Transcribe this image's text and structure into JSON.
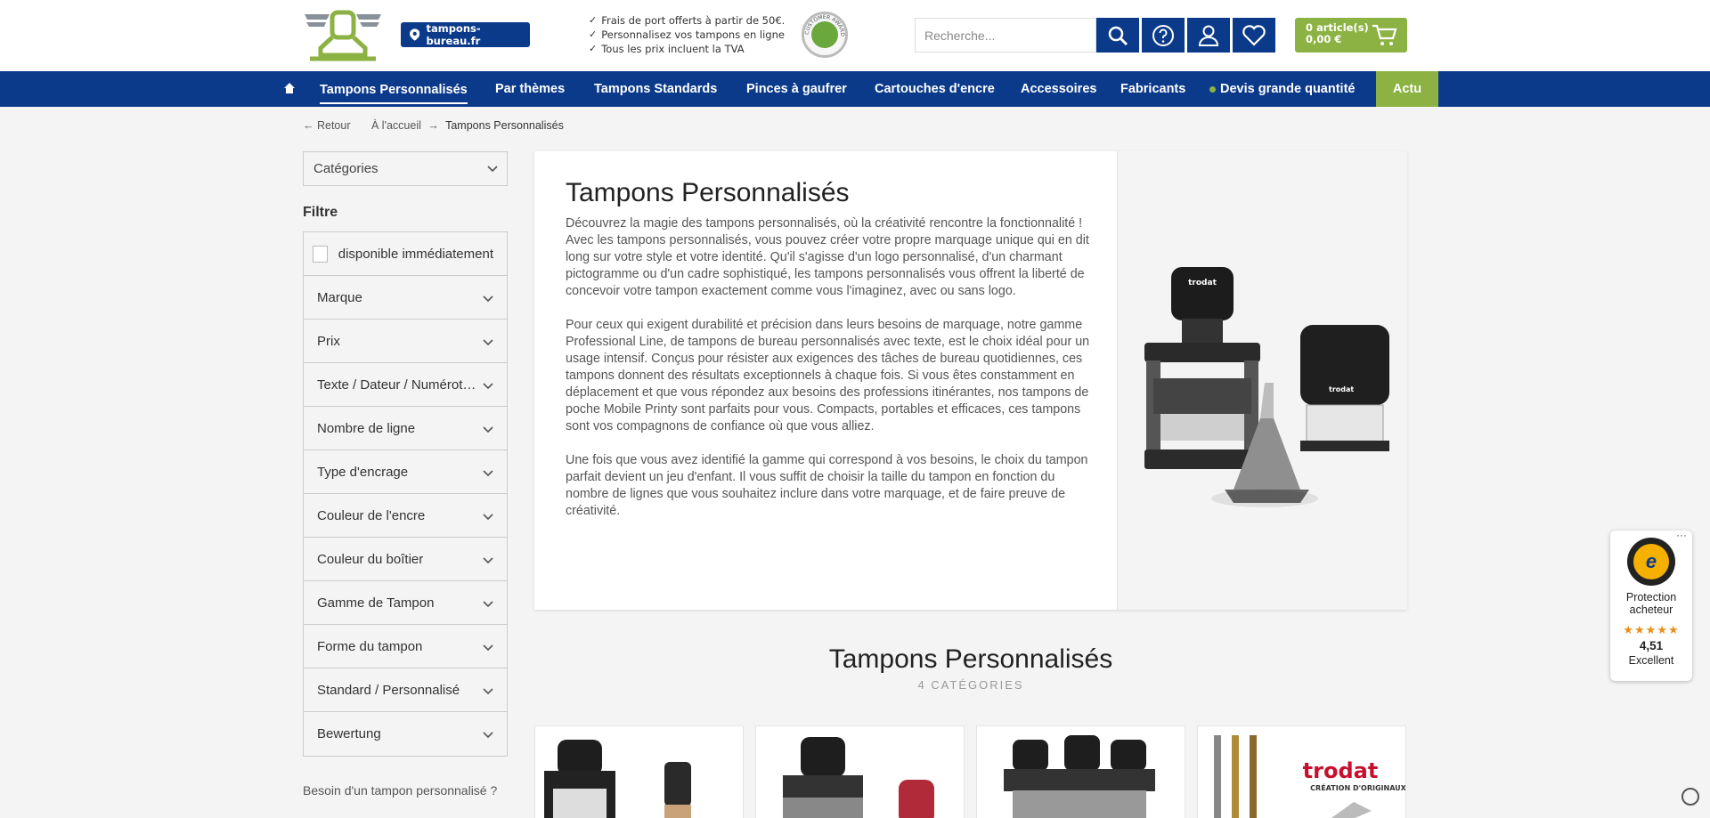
{
  "header": {
    "shop_button": "tampons-bureau.fr",
    "usps": [
      "Frais de port offerts à partir de 50€.",
      "Personnalisez vos tampons en ligne",
      "Tous les prix incluent la TVA"
    ],
    "award_text": "CUSTOMER AWARD",
    "search_placeholder": "Recherche...",
    "cart_items": "0 article(s)",
    "cart_total": "0,00 €",
    "icons": [
      "search-icon",
      "help-icon",
      "account-icon",
      "wishlist-icon",
      "cart-icon"
    ],
    "accent_color": "#0b3a8a",
    "brand_green": "#8cb243"
  },
  "nav": {
    "items": [
      "Tampons Personnalisés",
      "Par thèmes",
      "Tampons Standards",
      "Pinces à gaufrer",
      "Cartouches d'encre",
      "Accessoires",
      "Fabricants",
      "Devis grande quantité"
    ],
    "actu": "Actu",
    "active_index": 0
  },
  "breadcrumb": {
    "back": "← Retour",
    "home": "À l'accueil",
    "arrow": "→",
    "current": "Tampons Personnalisés"
  },
  "sidebar": {
    "category_select": "Catégories",
    "filter_title": "Filtre",
    "checkbox_label": "disponible immédiatement",
    "filters": [
      "Marque",
      "Prix",
      "Texte / Dateur / Numéroteur",
      "Nombre de ligne",
      "Type d'encrage",
      "Couleur de l'encre",
      "Couleur du boîtier",
      "Gamme de Tampon",
      "Forme du tampon",
      "Standard / Personnalisé",
      "Bewertung"
    ],
    "help_link": "Besoin d'un tampon personnalisé ?"
  },
  "hero": {
    "title": "Tampons Personnalisés",
    "paragraphs": [
      "Découvrez la magie des tampons personnalisés, où la créativité rencontre la fonctionnalité ! Avec les tampons personnalisés, vous pouvez créer votre propre marquage unique qui en dit long sur votre style et votre identité. Qu'il s'agisse d'un logo personnalisé, d'un charmant pictogramme ou d'un cadre sophistiqué, les tampons personnalisés vous offrent la liberté de concevoir votre tampon exactement comme vous l'imaginez, avec ou sans logo.",
      "Pour ceux qui exigent durabilité et précision dans leurs besoins de marquage, notre gamme Professional Line, de tampons de bureau personnalisés avec texte, est le choix idéal pour un usage intensif. Conçus pour résister aux exigences des tâches de bureau quotidiennes, ces tampons donnent des résultats exceptionnels à chaque fois. Si vous êtes constamment en déplacement et que vous répondez aux besoins des professions itinérantes, nos tampons de poche Mobile Printy sont parfaits pour vous. Compacts, portables et efficaces, ces tampons sont vos compagnons de confiance où que vous alliez.",
      "Une fois que vous avez identifié la gamme qui correspond à vos besoins, le choix du tampon parfait devient un jeu d'enfant. Il vous suffit de choisir la taille du tampon en fonction du nombre de lignes que vous souhaitez inclure dans votre marquage, et de faire preuve de créativité."
    ],
    "stamp_brand": "trodat"
  },
  "section": {
    "title": "Tampons Personnalisés",
    "subtitle": "4 CATÉGORIES",
    "card4_brand": "trodat",
    "card4_tagline": "CRÉATION D'ORIGINAUX"
  },
  "trust_badge": {
    "label": "Protection acheteur",
    "stars": "★★★★★",
    "score": "4,51",
    "rating_text": "Excellent",
    "more": "···"
  }
}
